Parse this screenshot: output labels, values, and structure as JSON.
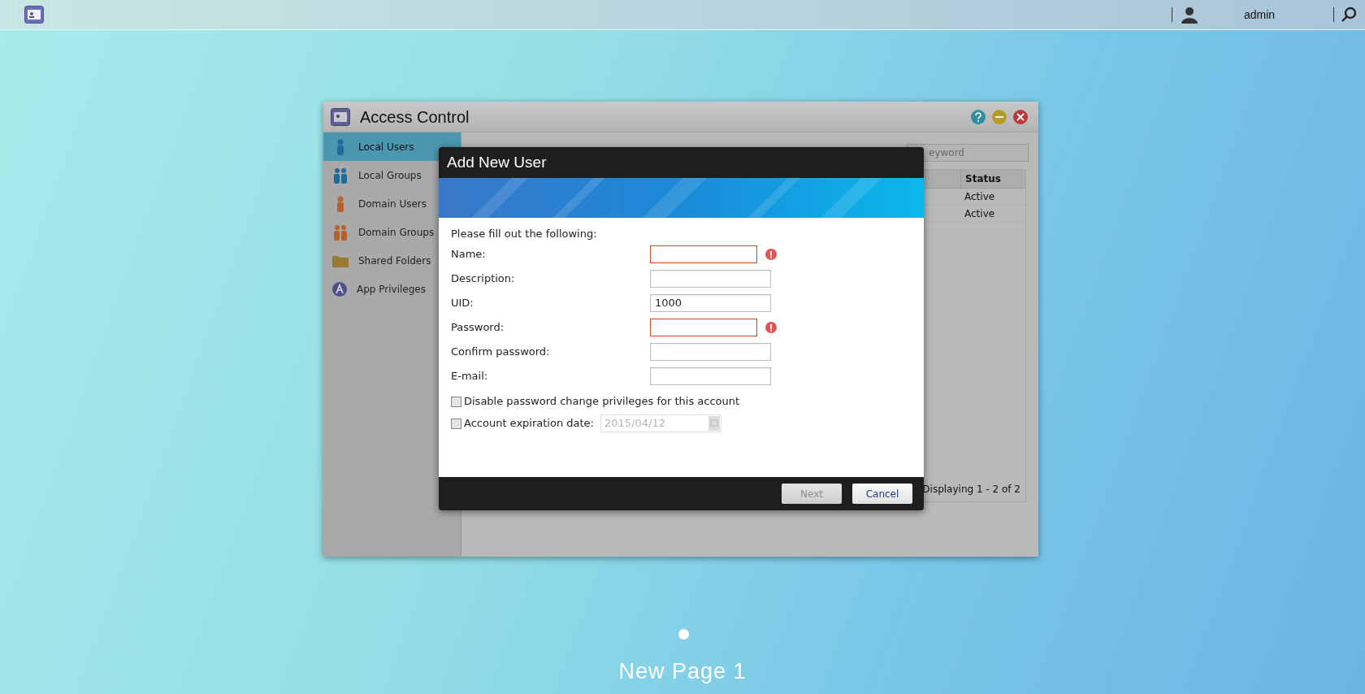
{
  "taskbar": {
    "user": "admin"
  },
  "window": {
    "title": "Access Control",
    "sidebar": [
      {
        "label": "Local Users",
        "selected": true
      },
      {
        "label": "Local Groups",
        "selected": false
      },
      {
        "label": "Domain Users",
        "selected": false
      },
      {
        "label": "Domain Groups",
        "selected": false
      },
      {
        "label": "Shared Folders",
        "selected": false
      },
      {
        "label": "App Privileges",
        "selected": false
      }
    ],
    "search": {
      "placeholder": "eyword"
    },
    "table": {
      "columns": [
        "Status"
      ],
      "rows": [
        [
          "Active"
        ],
        [
          "Active"
        ]
      ]
    },
    "footer": "Displaying 1 - 2 of 2"
  },
  "dialog": {
    "title": "Add New User",
    "intro": "Please fill out the following:",
    "fields": [
      {
        "label": "Name:",
        "invalid": true
      },
      {
        "label": "Description:",
        "invalid": false
      },
      {
        "label": "UID:",
        "value": "1000",
        "invalid": false
      },
      {
        "label": "Password:",
        "invalid": true
      },
      {
        "label": "Confirm password:",
        "invalid": false
      },
      {
        "label": "E-mail:",
        "invalid": false
      }
    ],
    "options": [
      {
        "kind": "plain",
        "label": "Disable password change privileges for this account",
        "checked": false
      },
      {
        "kind": "date",
        "label": "Account expiration date:",
        "checked": false,
        "date": "2015/04/12"
      }
    ],
    "buttons": [
      {
        "label": "Next",
        "disabled": true
      },
      {
        "label": "Cancel",
        "disabled": false
      }
    ]
  },
  "page_label": "New Page 1"
}
